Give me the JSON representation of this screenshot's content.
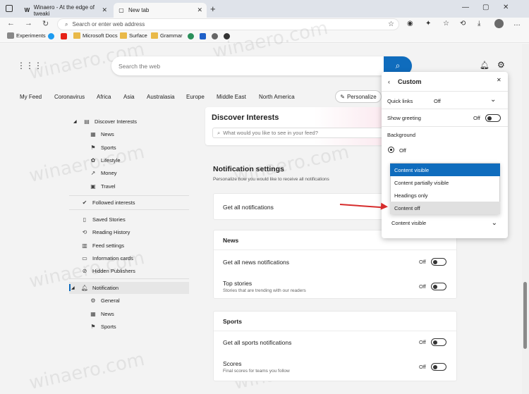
{
  "browser": {
    "tabs": [
      {
        "label": "Winaero - At the edge of tweaki",
        "favicon": "W",
        "active": false
      },
      {
        "label": "New tab",
        "favicon": "newtab-icon",
        "active": true
      }
    ],
    "address_placeholder": "Search or enter web address",
    "favorites": [
      {
        "label": "Experiments",
        "icon": "experiments-icon"
      },
      {
        "label": "",
        "icon": "twitter-icon"
      },
      {
        "label": "",
        "icon": "youtube-icon"
      },
      {
        "label": "Microsoft Docs",
        "icon": "folder-icon"
      },
      {
        "label": "Surface",
        "icon": "folder-icon"
      },
      {
        "label": "Grammar",
        "icon": "folder-icon"
      }
    ]
  },
  "search": {
    "placeholder": "Search the web"
  },
  "topics": [
    "My Feed",
    "Coronavirus",
    "Africa",
    "Asia",
    "Australasia",
    "Europe",
    "Middle East",
    "North America"
  ],
  "personalize_label": "Personalize",
  "sidebar": {
    "discover": "Discover Interests",
    "discover_items": [
      "News",
      "Sports",
      "Lifestyle",
      "Money",
      "Travel"
    ],
    "followed": "Followed interests",
    "misc": [
      "Saved Stories",
      "Reading History",
      "Feed settings",
      "Information cards",
      "Hidden Publishers"
    ],
    "notification": "Notification",
    "notification_items": [
      "General",
      "News",
      "Sports"
    ]
  },
  "main": {
    "discover_title": "Discover Interests",
    "discover_placeholder": "What would you like to see in your feed?",
    "notif_title": "Notification settings",
    "notif_sub": "Personalize how you would like to receive all notifications",
    "get_all": "Get all notifications",
    "news_head": "News",
    "news_all": "Get all news notifications",
    "top_stories": "Top stories",
    "top_stories_sub": "Stories that are trending with our readers",
    "sports_head": "Sports",
    "sports_all": "Get all sports notifications",
    "scores": "Scores",
    "scores_sub": "Final scores for teams you follow",
    "off": "Off"
  },
  "flyout": {
    "title": "Custom",
    "quick_links_label": "Quick links",
    "quick_links_value": "Off",
    "show_greeting_label": "Show greeting",
    "show_greeting_value": "Off",
    "background_label": "Background",
    "background_option_off": "Off",
    "content_options": [
      "Content visible",
      "Content partially visible",
      "Headings only",
      "Content off"
    ],
    "selected_option": "Content visible",
    "content_select_value": "Content visible"
  },
  "watermark": "winaero.com",
  "colors": {
    "accent": "#0f6cbd",
    "annotation_arrow": "#d62c2c"
  }
}
